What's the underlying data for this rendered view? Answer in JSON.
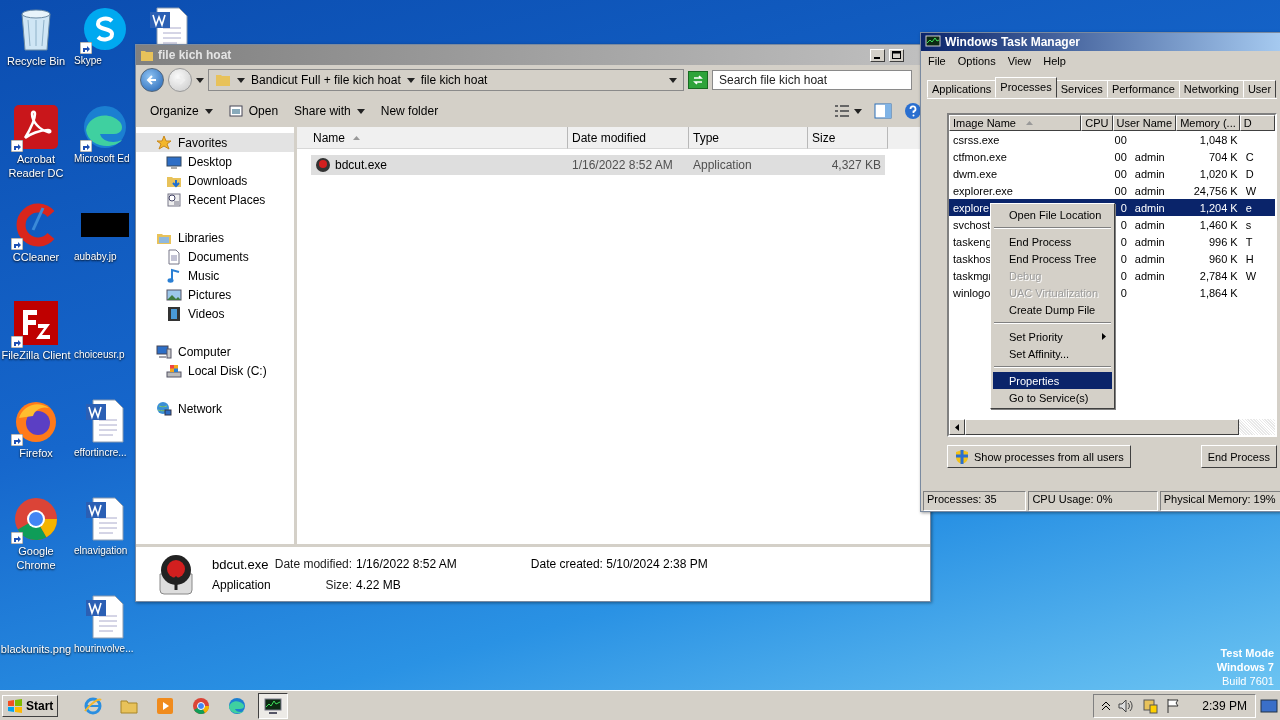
{
  "desktop_icons": [
    {
      "label": "Recycle Bin",
      "kind": "bin",
      "shortcut": false
    },
    {
      "label": "Acrobat Reader DC",
      "kind": "pdf",
      "shortcut": true
    },
    {
      "label": "CCleaner",
      "kind": "ccleaner",
      "shortcut": true
    },
    {
      "label": "FileZilla Client",
      "kind": "filezilla",
      "shortcut": true
    },
    {
      "label": "Firefox",
      "kind": "firefox",
      "shortcut": true
    },
    {
      "label": "Google Chrome",
      "kind": "chrome",
      "shortcut": true
    },
    {
      "label": "blackunits.png",
      "kind": "blank",
      "shortcut": false
    },
    {
      "label": "Skype",
      "kind": "skype",
      "shortcut": true
    },
    {
      "label": "Microsoft Ed",
      "kind": "edge",
      "shortcut": true
    },
    {
      "label": "aubaby.jp",
      "kind": "image",
      "shortcut": false
    },
    {
      "label": "choiceusr.p",
      "kind": "blank",
      "shortcut": false
    },
    {
      "label": "effortincre...",
      "kind": "doc",
      "shortcut": false
    },
    {
      "label": "elnavigation",
      "kind": "doc",
      "shortcut": false
    },
    {
      "label": "hourinvolve...",
      "kind": "doc",
      "shortcut": false
    },
    {
      "kind": "doc",
      "shortcut": false
    }
  ],
  "os_notice": [
    "Test Mode",
    "Windows 7",
    "Build 7601"
  ],
  "explorer": {
    "title": "file kich hoat",
    "breadcrumb": [
      "Bandicut Full + file kich hoat",
      "file kich hoat"
    ],
    "search": {
      "placeholder": "Search file kich hoat"
    },
    "toolbar": [
      {
        "label": "Organize",
        "kind": "menu"
      },
      {
        "label": "Open",
        "kind": "open"
      },
      {
        "label": "Share with",
        "kind": "menu"
      },
      {
        "label": "New folder",
        "kind": "plain"
      }
    ],
    "nav": [
      {
        "label": "Favorites",
        "kind": "star",
        "selected": true,
        "children": [
          {
            "label": "Desktop",
            "kind": "desktop",
            "selected": false
          },
          {
            "label": "Downloads",
            "kind": "downloads",
            "selected": false
          },
          {
            "label": "Recent Places",
            "kind": "recent",
            "selected": false
          }
        ]
      },
      {
        "label": "Libraries",
        "kind": "library",
        "selected": false,
        "children": [
          {
            "label": "Documents",
            "kind": "documents",
            "selected": false
          },
          {
            "label": "Music",
            "kind": "music",
            "selected": false
          },
          {
            "label": "Pictures",
            "kind": "pictures",
            "selected": false
          },
          {
            "label": "Videos",
            "kind": "videos",
            "selected": false
          }
        ]
      },
      {
        "label": "Computer",
        "kind": "computer",
        "selected": false,
        "children": [
          {
            "label": "Local Disk (C:)",
            "kind": "disk",
            "selected": false
          }
        ]
      },
      {
        "label": "Network",
        "kind": "network",
        "selected": false
      }
    ],
    "columns": [
      "Name",
      "Date modified",
      "Type",
      "Size"
    ],
    "files": [
      {
        "name": "bdcut.exe",
        "date_modified": "1/16/2022 8:52 AM",
        "type": "Application",
        "size": "4,327 KB",
        "selected": true
      }
    ],
    "details": {
      "name": "bdcut.exe",
      "type": "Application",
      "fields": [
        {
          "label": "Date modified:",
          "value": "1/16/2022 8:52 AM"
        },
        {
          "label": "Size:",
          "value": "4.22 MB"
        },
        {
          "label": "Date created:",
          "value": "5/10/2024 2:38 PM"
        }
      ]
    }
  },
  "task_manager": {
    "title": "Windows Task Manager",
    "menu": [
      "File",
      "Options",
      "View",
      "Help"
    ],
    "tabs": [
      {
        "label": "Applications",
        "selected": false
      },
      {
        "label": "Processes",
        "selected": true
      },
      {
        "label": "Services",
        "selected": false
      },
      {
        "label": "Performance",
        "selected": false
      },
      {
        "label": "Networking",
        "selected": false
      },
      {
        "label": "User",
        "selected": false
      }
    ],
    "columns": [
      "Image Name",
      "CPU",
      "User Name",
      "Memory (...",
      "D"
    ],
    "rows": [
      {
        "image_name": "csrss.exe",
        "cpu": "00",
        "user_name": "",
        "memory": "1,048 K",
        "column_5": "",
        "selected": false
      },
      {
        "image_name": "ctfmon.exe",
        "cpu": "00",
        "user_name": "admin",
        "memory": "704 K",
        "column_5": "C",
        "selected": false
      },
      {
        "image_name": "dwm.exe",
        "cpu": "00",
        "user_name": "admin",
        "memory": "1,020 K",
        "column_5": "D",
        "selected": false
      },
      {
        "image_name": "explorer.exe",
        "cpu": "00",
        "user_name": "admin",
        "memory": "24,756 K",
        "column_5": "W",
        "selected": false
      },
      {
        "image_name": "explore",
        "cpu": "0",
        "user_name": "admin",
        "memory": "1,204 K",
        "column_5": "e",
        "selected": true
      },
      {
        "image_name": "svchost",
        "cpu": "0",
        "user_name": "admin",
        "memory": "1,460 K",
        "column_5": "s",
        "selected": false
      },
      {
        "image_name": "taskeng",
        "cpu": "0",
        "user_name": "admin",
        "memory": "996 K",
        "column_5": "T",
        "selected": false
      },
      {
        "image_name": "taskhos",
        "cpu": "0",
        "user_name": "admin",
        "memory": "960 K",
        "column_5": "H",
        "selected": false
      },
      {
        "image_name": "taskmgr",
        "cpu": "0",
        "user_name": "admin",
        "memory": "2,784 K",
        "column_5": "W",
        "selected": false
      },
      {
        "image_name": "winlogo",
        "cpu": "0",
        "user_name": "",
        "memory": "1,864 K",
        "column_5": "",
        "selected": false
      }
    ],
    "show_all_button": "Show processes from all users",
    "end_button": "End Process",
    "status": [
      "Processes: 35",
      "CPU Usage: 0%",
      "Physical Memory: 19%"
    ]
  },
  "context_menu": [
    [
      {
        "label": "Open File Location",
        "disabled": false,
        "selected": false,
        "submenu": false
      }
    ],
    [
      {
        "label": "End Process",
        "disabled": false,
        "selected": false,
        "submenu": false
      },
      {
        "label": "End Process Tree",
        "disabled": false,
        "selected": false,
        "submenu": false
      },
      {
        "label": "Debug",
        "disabled": true,
        "selected": false,
        "submenu": false
      },
      {
        "label": "UAC Virtualization",
        "disabled": true,
        "selected": false,
        "submenu": false
      },
      {
        "label": "Create Dump File",
        "disabled": false,
        "selected": false,
        "submenu": false
      }
    ],
    [
      {
        "label": "Set Priority",
        "disabled": false,
        "selected": false,
        "submenu": true
      },
      {
        "label": "Set Affinity...",
        "disabled": false,
        "selected": false,
        "submenu": false
      }
    ],
    [
      {
        "label": "Properties",
        "disabled": false,
        "selected": true,
        "submenu": false
      },
      {
        "label": "Go to Service(s)",
        "disabled": false,
        "selected": false,
        "submenu": false
      }
    ]
  ],
  "taskbar": {
    "start": "Start",
    "apps": [
      {
        "kind": "ie",
        "active": false
      },
      {
        "kind": "folder",
        "active": false
      },
      {
        "kind": "media",
        "active": false
      },
      {
        "kind": "chrome",
        "active": false
      },
      {
        "kind": "edge",
        "active": false
      },
      {
        "kind": "taskmgr",
        "active": true
      }
    ],
    "clock": "2:39 PM"
  }
}
